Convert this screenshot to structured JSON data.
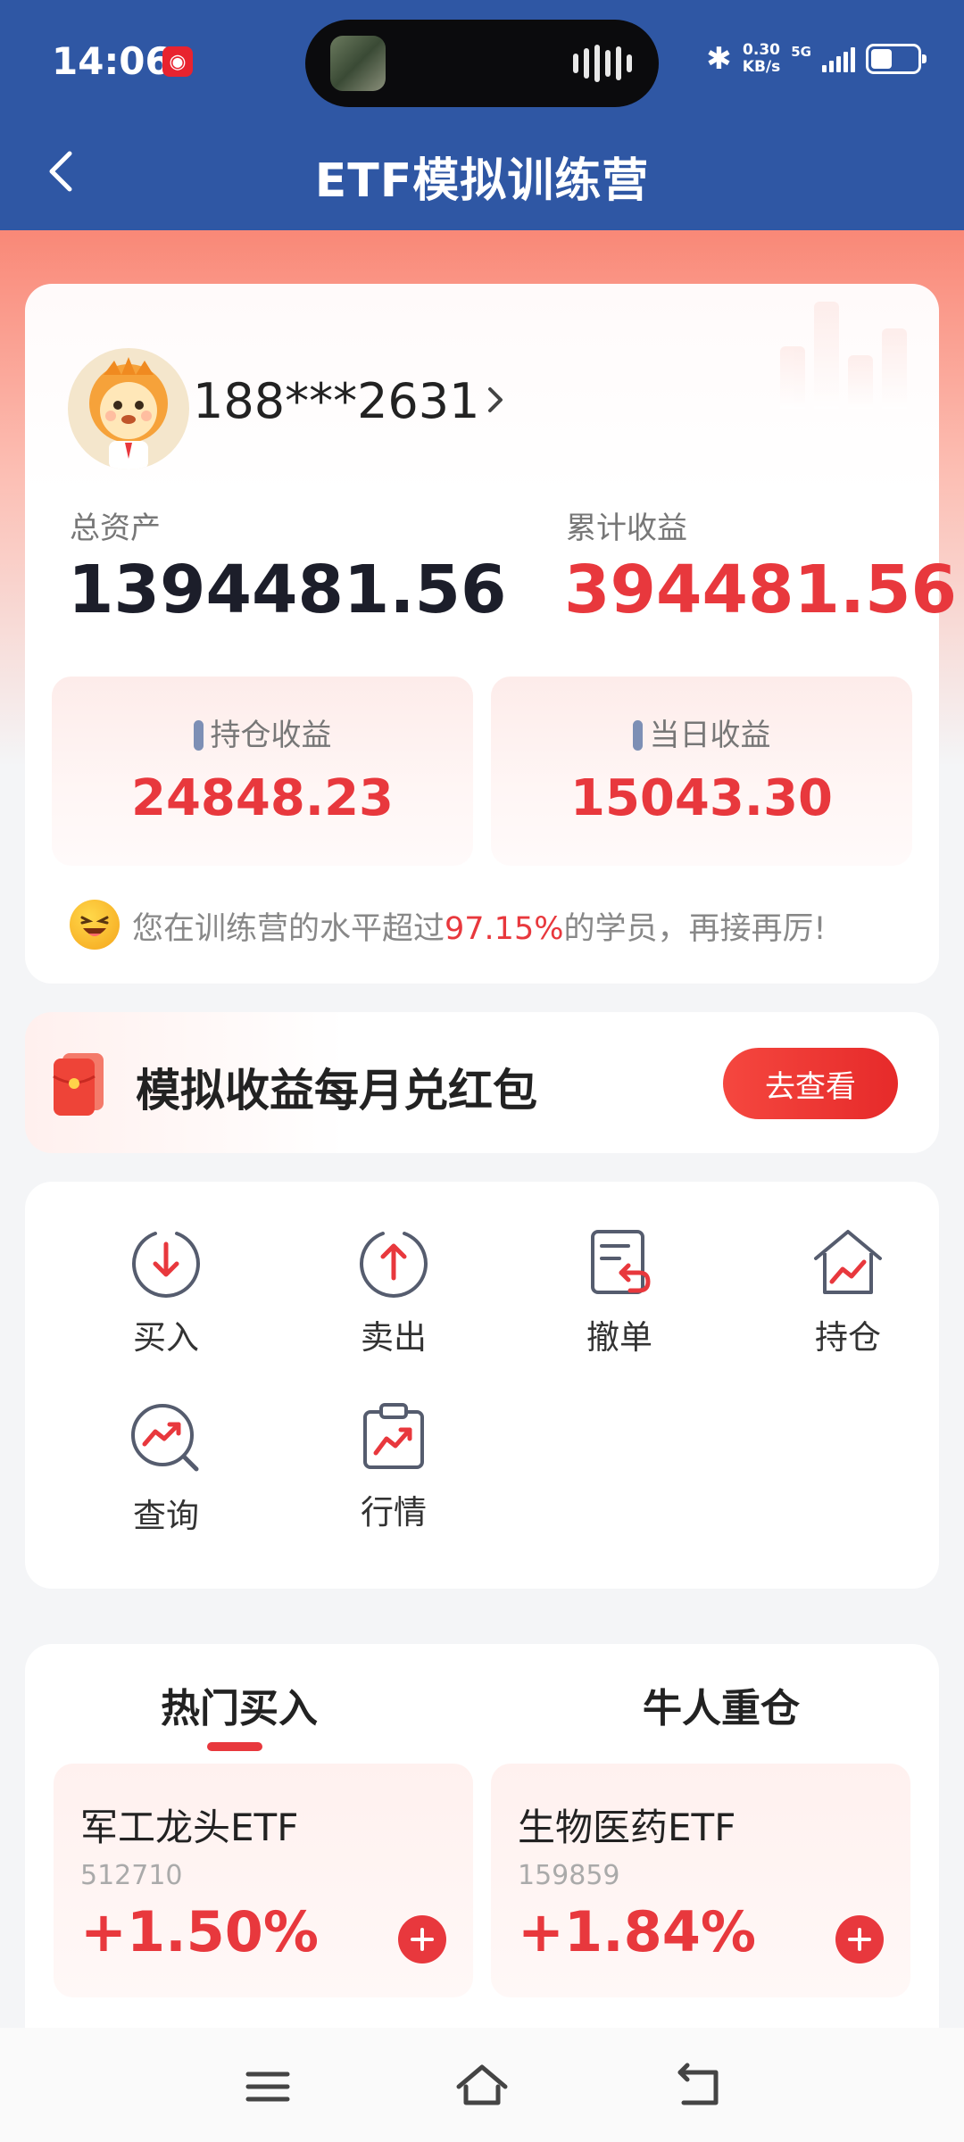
{
  "status_bar": {
    "time": "14:06",
    "net_speed_value": "0.30",
    "net_speed_unit": "KB/s",
    "network": "5G",
    "battery_level": 0.45
  },
  "header": {
    "title": "ETF模拟训练营"
  },
  "account": {
    "phone": "188***2631",
    "total_assets_label": "总资产",
    "total_assets_value": "1394481.56",
    "cumulative_label": "累计收益",
    "cumulative_value": "394481.56",
    "holding_label": "持仓收益",
    "holding_value": "24848.23",
    "daily_label": "当日收益",
    "daily_value": "15043.30",
    "rank_prefix": "您在训练营的水平超过",
    "rank_percent": "97.15%",
    "rank_suffix": "的学员，再接再厉!"
  },
  "banner": {
    "text": "模拟收益每月兑红包",
    "button": "去查看"
  },
  "actions": [
    {
      "label": "买入",
      "icon": "buy-icon"
    },
    {
      "label": "卖出",
      "icon": "sell-icon"
    },
    {
      "label": "撤单",
      "icon": "cancel-order-icon"
    },
    {
      "label": "持仓",
      "icon": "holdings-icon"
    },
    {
      "label": "查询",
      "icon": "query-icon"
    },
    {
      "label": "行情",
      "icon": "market-icon"
    }
  ],
  "hot": {
    "tab_hot": "热门买入",
    "tab_niu": "牛人重仓",
    "items": [
      {
        "name": "军工龙头ETF",
        "code": "512710",
        "change": "+1.50%"
      },
      {
        "name": "生物医药ETF",
        "code": "159859",
        "change": "+1.84%"
      }
    ]
  },
  "colors": {
    "header_bg": "#2f57a4",
    "accent_red": "#e8383d",
    "dark_text": "#1c1e2a"
  }
}
